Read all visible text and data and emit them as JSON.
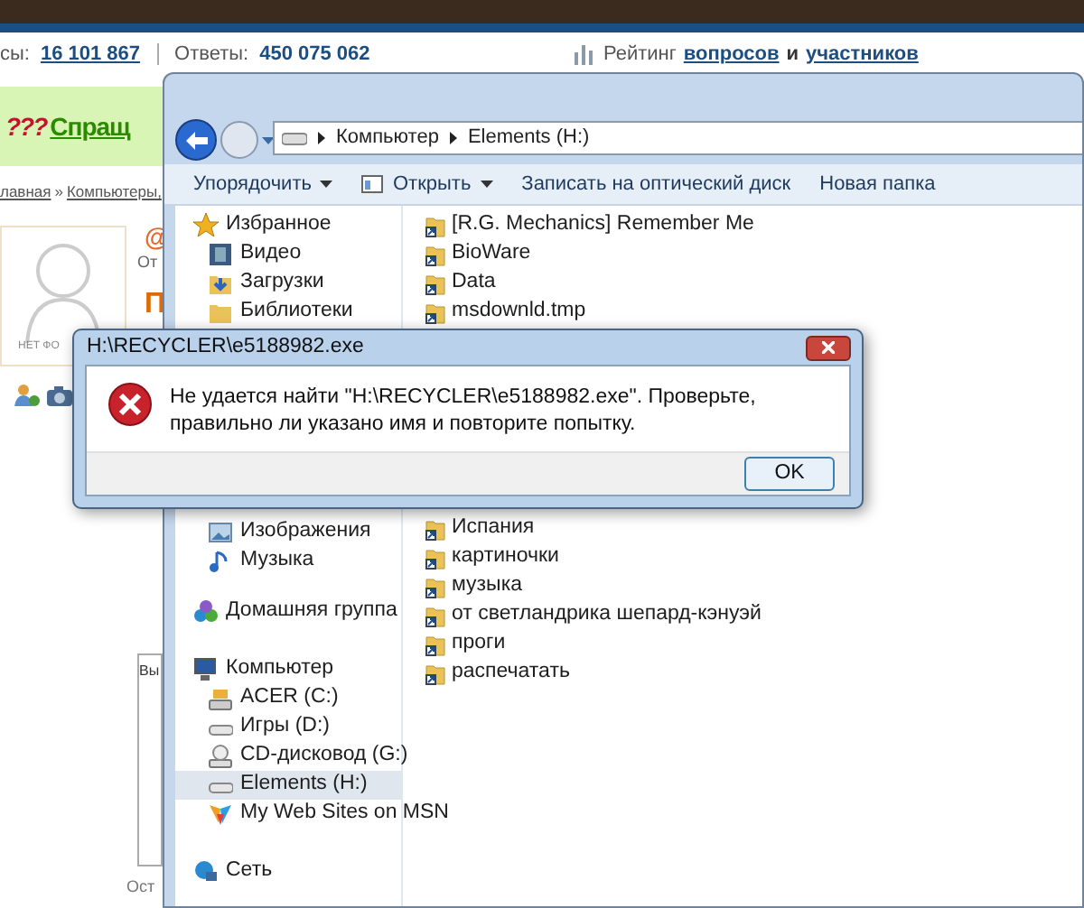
{
  "web_page": {
    "stats": [
      {
        "label": "сы:",
        "value": "16 101 867"
      },
      {
        "label": "Ответы:",
        "value": "450 075 062"
      }
    ],
    "rating": {
      "label": "Рейтинг",
      "link_questions": "вопросов",
      "conjunction": "и",
      "link_members": "участников"
    },
    "logo_mark": "???",
    "logo_text": "Спращ",
    "breadcrumb": [
      {
        "text": "лавная"
      },
      {
        "text": "»"
      },
      {
        "text": "Компьютеры,"
      }
    ],
    "avatar_caption": "НЕТ ФО",
    "mention": "@",
    "reply_label": "От",
    "title_fragment": "П",
    "box_fragment": "Вы",
    "footer_fragment": "Ост"
  },
  "explorer": {
    "path": [
      "Компьютер",
      "Elements (H:)"
    ],
    "toolbar": [
      {
        "label": "Упорядочить",
        "dropdown": true
      },
      {
        "label": "Открыть",
        "dropdown": true
      },
      {
        "label": "Записать на оптический диск",
        "dropdown": false
      },
      {
        "label": "Новая папка",
        "dropdown": false
      }
    ],
    "nav": [
      {
        "label": "Избранное",
        "kind": "star",
        "children": [
          {
            "label": "Видео",
            "kind": "video",
            "selected": false
          },
          {
            "label": "Загрузки",
            "kind": "downloads",
            "selected": false
          },
          {
            "label": "Библиотеки",
            "kind": "library",
            "selected": false
          }
        ]
      },
      {
        "children": [
          {
            "label": "Изображения",
            "kind": "images",
            "selected": false
          },
          {
            "label": "Музыка",
            "kind": "music",
            "selected": false
          }
        ]
      },
      {
        "label": "Домашняя группа",
        "kind": "homegroup"
      },
      {
        "label": "Компьютер",
        "kind": "computer",
        "children": [
          {
            "label": "ACER (C:)",
            "kind": "system_drive",
            "selected": false
          },
          {
            "label": "Игры (D:)",
            "kind": "drive",
            "selected": false
          },
          {
            "label": "CD-дисковод (G:)",
            "kind": "cd",
            "selected": false
          },
          {
            "label": "Elements (H:)",
            "kind": "drive",
            "selected": true
          },
          {
            "label": "My Web Sites on MSN",
            "kind": "msn",
            "selected": false
          }
        ]
      },
      {
        "label": "Сеть",
        "kind": "network"
      }
    ],
    "files": [
      {
        "name": "[R.G. Mechanics] Remember Me"
      },
      {
        "name": "BioWare"
      },
      {
        "name": "Data"
      },
      {
        "name": "msdownld.tmp"
      },
      {
        "name": "Испания"
      },
      {
        "name": "картиночки"
      },
      {
        "name": "музыка"
      },
      {
        "name": "от светландрика шепард-кэнуэй"
      },
      {
        "name": "проги"
      },
      {
        "name": "распечатать"
      }
    ]
  },
  "dialog": {
    "title": "H:\\RECYCLER\\e5188982.exe",
    "message": "Не удается найти \"H:\\RECYCLER\\e5188982.exe\". Проверьте, правильно ли указано имя и повторите попытку.",
    "button": "OK"
  }
}
